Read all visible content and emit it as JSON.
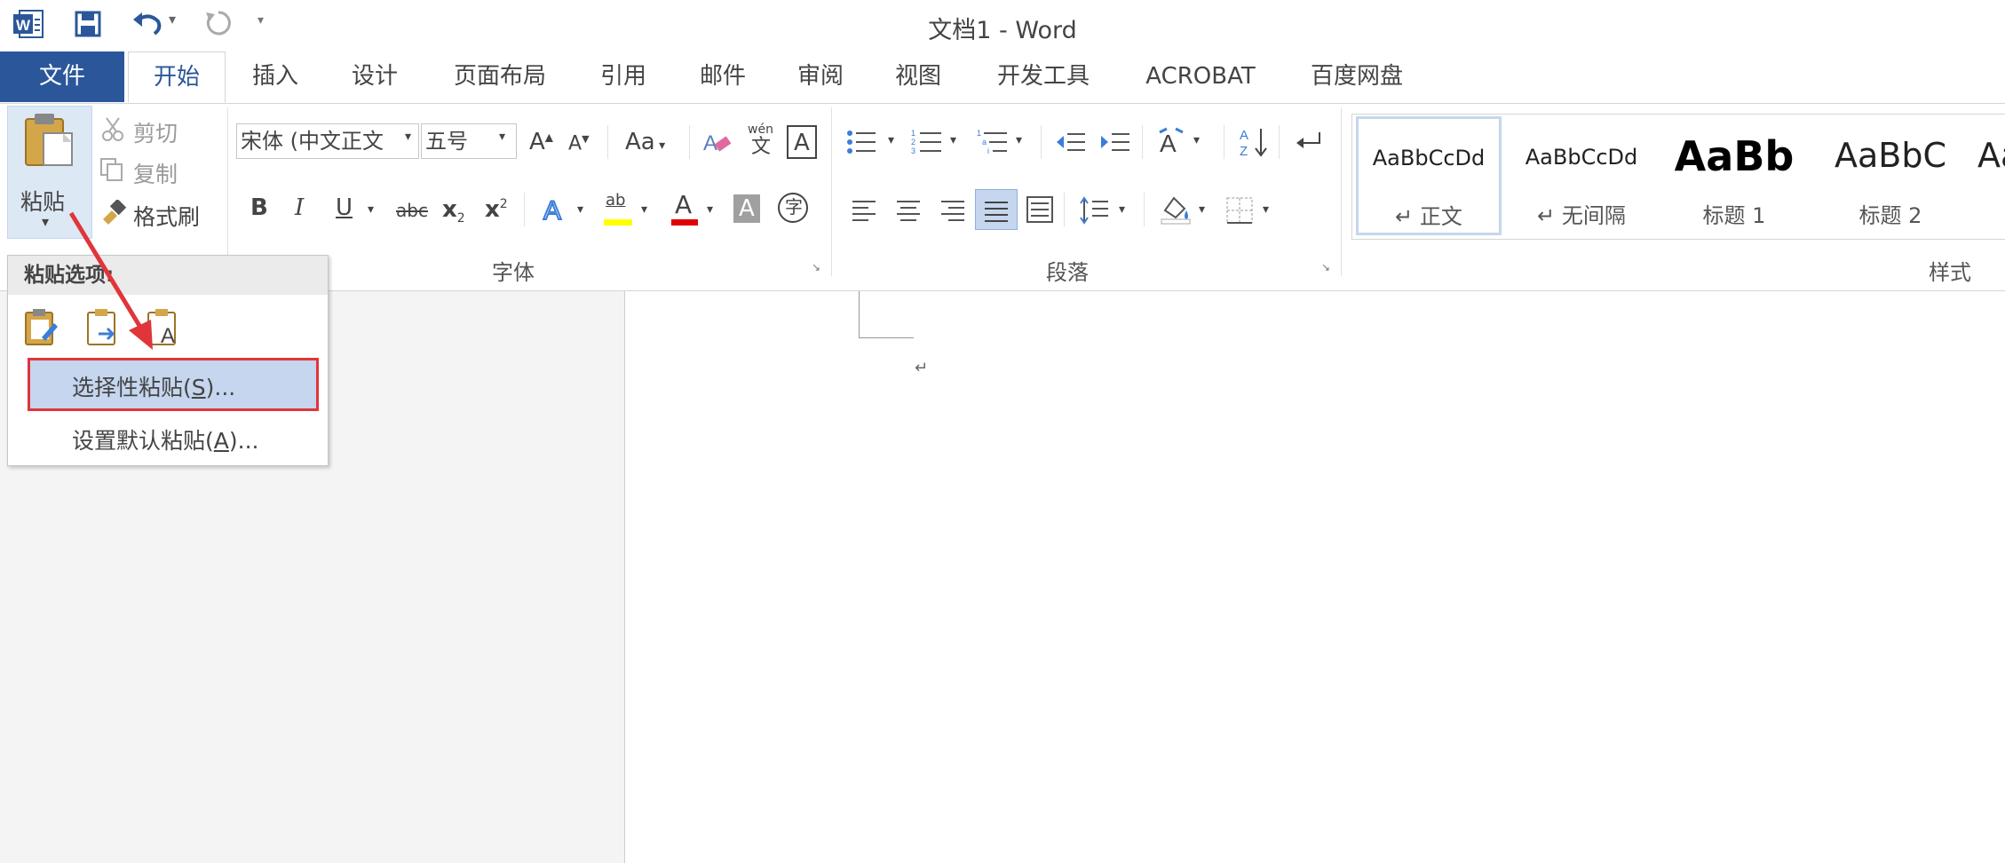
{
  "window": {
    "title": "文档1 - Word"
  },
  "tabs": {
    "file": "文件",
    "home": "开始",
    "insert": "插入",
    "design": "设计",
    "layout": "页面布局",
    "references": "引用",
    "mailings": "邮件",
    "review": "审阅",
    "view": "视图",
    "developer": "开发工具",
    "acrobat": "ACROBAT",
    "baidu": "百度网盘"
  },
  "clipboard": {
    "paste": "粘贴",
    "cut": "剪切",
    "copy": "复制",
    "format_painter": "格式刷"
  },
  "font": {
    "group_label": "字体",
    "font_name": "宋体 (中文正文",
    "font_size": "五号",
    "case": "Aa",
    "phonetic_top": "wén",
    "phonetic_bottom": "文",
    "char_circle": "字",
    "bold": "B",
    "italic": "I",
    "underline": "U",
    "strike": "abc",
    "sub": "x",
    "sup": "x",
    "sub_mark": "2",
    "sup_mark": "2",
    "font_color": "A",
    "char_shading": "A",
    "highlight": "ab"
  },
  "paragraph": {
    "group_label": "段落"
  },
  "styles": {
    "group_label": "样式",
    "items": [
      {
        "sample": "AaBbCcDd",
        "name": "↵ 正文"
      },
      {
        "sample": "AaBbCcDd",
        "name": "↵ 无间隔"
      },
      {
        "sample": "AaBb",
        "name": "标题 1"
      },
      {
        "sample": "AaBbC",
        "name": "标题 2"
      },
      {
        "sample": "Aa",
        "name": ""
      }
    ]
  },
  "paste_menu": {
    "header": "粘贴选项:",
    "paste_special_main": "选择性粘贴(",
    "paste_special_key": "S",
    "paste_special_tail": ")...",
    "set_default_main": "设置默认粘贴(",
    "set_default_key": "A",
    "set_default_tail": ")..."
  },
  "document": {
    "paragraph_mark": "↵"
  },
  "colors": {
    "word_blue": "#2b579a",
    "highlight_box": "#e0353a",
    "arrow": "#e0353a",
    "selected_item": "#c5d6ee"
  }
}
